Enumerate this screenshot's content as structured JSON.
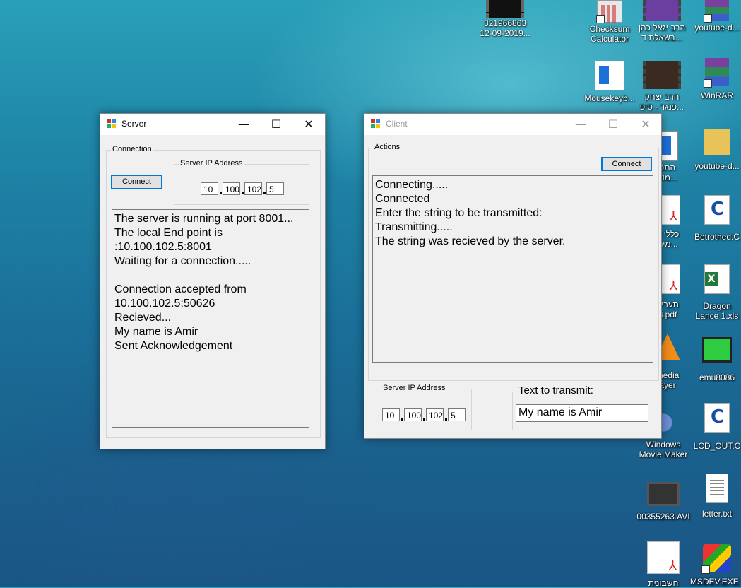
{
  "desktop": {
    "icons": [
      {
        "id": "video1",
        "label": "321966863\n12-09-2019..."
      },
      {
        "id": "checksum",
        "label": "Checksum\nCalculator"
      },
      {
        "id": "rav-yigal",
        "label": "הרב יגאל כהן\nבשאלת ד..."
      },
      {
        "id": "youtube-dl-1",
        "label": "youtube-d..."
      },
      {
        "id": "mousekeyb",
        "label": "Mousekeyb..."
      },
      {
        "id": "rav-yitzhak",
        "label": "הרב יצחק\nפנגר - סיפ..."
      },
      {
        "id": "winrar",
        "label": "WinRAR"
      },
      {
        "id": "hebrew-folder",
        "label": "התכ\nמוד..."
      },
      {
        "id": "youtube-dl-2",
        "label": "youtube-d..."
      },
      {
        "id": "klali-pdf",
        "label": "כללי ה\nמים..."
      },
      {
        "id": "betrothed",
        "label": "Betrothed.C"
      },
      {
        "id": "taarif-pdf",
        "label": "תעריפ\n3.pdf"
      },
      {
        "id": "dragon-lance",
        "label": "Dragon\nLance 1.xls"
      },
      {
        "id": "vlc",
        "label": "media\nayer"
      },
      {
        "id": "emu8086",
        "label": "emu8086"
      },
      {
        "id": "movie-maker",
        "label": "Windows\nMovie Maker"
      },
      {
        "id": "lcd-out",
        "label": "LCD_OUT.C"
      },
      {
        "id": "avi-file",
        "label": "00355263.AVI"
      },
      {
        "id": "letter",
        "label": "letter.txt"
      },
      {
        "id": "heshbonit",
        "label": "חשבונית"
      },
      {
        "id": "msdev",
        "label": "MSDEV.EXE -"
      }
    ]
  },
  "server": {
    "title": "Server",
    "connection_group": "Connection",
    "connect_label": "Connect",
    "ip_group": "Server IP Address",
    "ip": [
      "10",
      "100",
      "102",
      "5"
    ],
    "log": [
      "The server is running at port 8001...",
      "The local End point is",
      ":10.100.102.5:8001",
      "Waiting for a connection.....",
      "",
      "Connection accepted from",
      "10.100.102.5:50626",
      "Recieved...",
      "My name is Amir",
      "Sent Acknowledgement"
    ]
  },
  "client": {
    "title": "Client",
    "actions_group": "Actions",
    "connect_label": "Connect",
    "log": [
      "Connecting.....",
      "Connected",
      "Enter the string to be transmitted:",
      "Transmitting.....",
      "The string was recieved by the server."
    ],
    "ip_group": "Server IP Address",
    "ip": [
      "10",
      "100",
      "102",
      "5"
    ],
    "text_group": "Text to transmit:",
    "text_value": "My name is Amir"
  },
  "titlebar": {
    "minimize_glyph": "—",
    "maximize_glyph": "☐",
    "close_glyph": "✕"
  }
}
